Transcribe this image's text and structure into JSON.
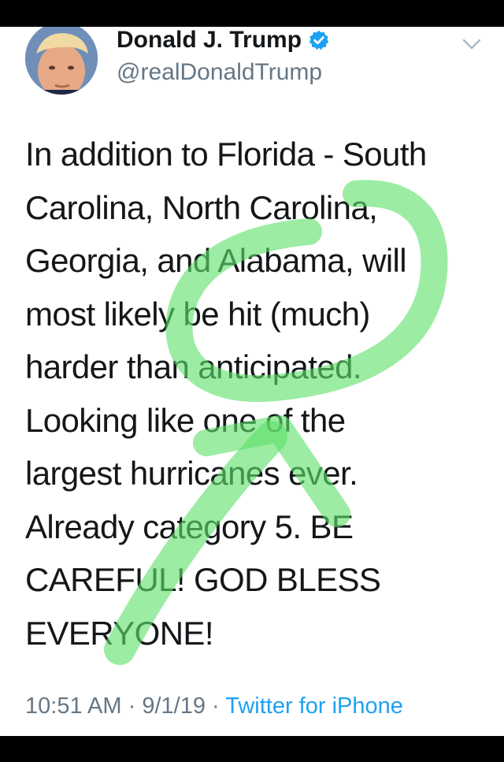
{
  "author": {
    "name": "Donald J. Trump",
    "handle": "@realDonaldTrump",
    "verified": true
  },
  "tweet": {
    "text": "In addition to Florida - South\nCarolina, North Carolina,\nGeorgia, and Alabama, will\nmost likely be hit (much)\nharder than anticipated.\nLooking like one of the\nlargest hurricanes ever.\nAlready category 5. BE\nCAREFUL! GOD BLESS\nEVERYONE!"
  },
  "meta": {
    "time": "10:51 AM",
    "separator": "·",
    "date": "9/1/19",
    "source": "Twitter for iPhone"
  },
  "colors": {
    "verified_badge": "#1da1f2",
    "link": "#1da1f2",
    "secondary_text": "#657786",
    "annotation_marker": "#5fe06a"
  },
  "icons": {
    "verified": "verified-badge-icon",
    "menu": "chevron-down-icon"
  }
}
